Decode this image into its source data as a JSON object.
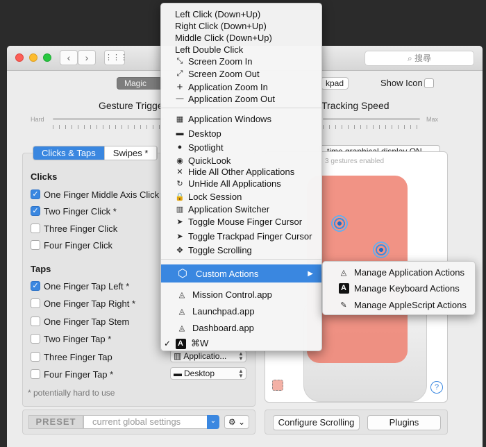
{
  "window": {
    "search_placeholder": "搜尋",
    "seg_magic": "Magic Mo",
    "seg_trackpad": "kpad",
    "show_icon": "Show Icon",
    "gesture_trigger": "Gesture Trigge",
    "tracking_speed": "Tracking Speed",
    "slider_hard": "Hard",
    "slider_max": "Max",
    "display_toggle": "-time graphical display ON",
    "gestures_enabled": "3 gestures enabled"
  },
  "tabs": [
    "Clicks & Taps",
    "Swipes *"
  ],
  "clicks": {
    "title": "Clicks",
    "items": [
      {
        "label": "One Finger Middle Axis Click",
        "checked": true
      },
      {
        "label": "Two Finger Click *",
        "checked": true
      },
      {
        "label": "Three Finger Click",
        "checked": false
      },
      {
        "label": "Four Finger Click",
        "checked": false
      }
    ]
  },
  "taps": {
    "title": "Taps",
    "items": [
      {
        "label": "One Finger Tap Left *",
        "checked": true
      },
      {
        "label": "One Finger Tap Right *",
        "checked": false
      },
      {
        "label": "One Finger Tap  Stem",
        "checked": false
      },
      {
        "label": "Two Finger Tap *",
        "checked": false
      },
      {
        "label": "Three Finger Tap",
        "checked": false
      },
      {
        "label": "Four Finger Tap *",
        "checked": false
      }
    ],
    "popup_three": "Applicatio...",
    "popup_four": "Desktop"
  },
  "footnote": "* potentially hard to use",
  "preset": {
    "label": "PRESET",
    "value": "current global settings"
  },
  "buttons": {
    "configure_scrolling": "Configure Scrolling",
    "plugins": "Plugins"
  },
  "menu": {
    "items": [
      {
        "label": "Left Click (Down+Up)",
        "icon": ""
      },
      {
        "label": "Right Click (Down+Up)",
        "icon": ""
      },
      {
        "label": "Middle Click (Down+Up)",
        "icon": ""
      },
      {
        "label": "Left Double Click",
        "icon": ""
      },
      {
        "label": "Screen Zoom In",
        "icon": "zoom-in-icon"
      },
      {
        "label": "Screen Zoom Out",
        "icon": "zoom-out-icon"
      },
      {
        "label": "Application Zoom In",
        "icon": "plus-icon"
      },
      {
        "label": "Application Zoom Out",
        "icon": "minus-icon"
      },
      {
        "label": "Application Windows",
        "icon": "windows-icon"
      },
      {
        "label": "Desktop",
        "icon": "desktop-icon"
      },
      {
        "label": "Spotlight",
        "icon": "spotlight-icon"
      },
      {
        "label": "QuickLook",
        "icon": "eye-icon"
      },
      {
        "label": "Hide All Other Applications",
        "icon": "x-icon"
      },
      {
        "label": "UnHide All Applications",
        "icon": "refresh-icon"
      },
      {
        "label": "Lock Session",
        "icon": "lock-icon"
      },
      {
        "label": "Application Switcher",
        "icon": "switcher-icon"
      },
      {
        "label": "Toggle Mouse Finger Cursor",
        "icon": "cursor-icon"
      },
      {
        "label": "Toggle Trackpad Finger Cursor",
        "icon": "cursor-icon"
      },
      {
        "label": "Toggle Scrolling",
        "icon": "move-icon"
      },
      {
        "label": "Custom Actions",
        "icon": "cube-icon"
      },
      {
        "label": "Mission Control.app",
        "icon": "app-icon"
      },
      {
        "label": "Launchpad.app",
        "icon": "app-icon"
      },
      {
        "label": "Dashboard.app",
        "icon": "app-icon"
      },
      {
        "label": "⌘W",
        "icon": "keyboard-icon"
      }
    ]
  },
  "submenu": {
    "items": [
      "Manage Application Actions",
      "Manage Keyboard Actions",
      "Manage AppleScript Actions"
    ]
  },
  "colors": {
    "accent": "#3a87e0",
    "overlay": "#ef8070"
  }
}
